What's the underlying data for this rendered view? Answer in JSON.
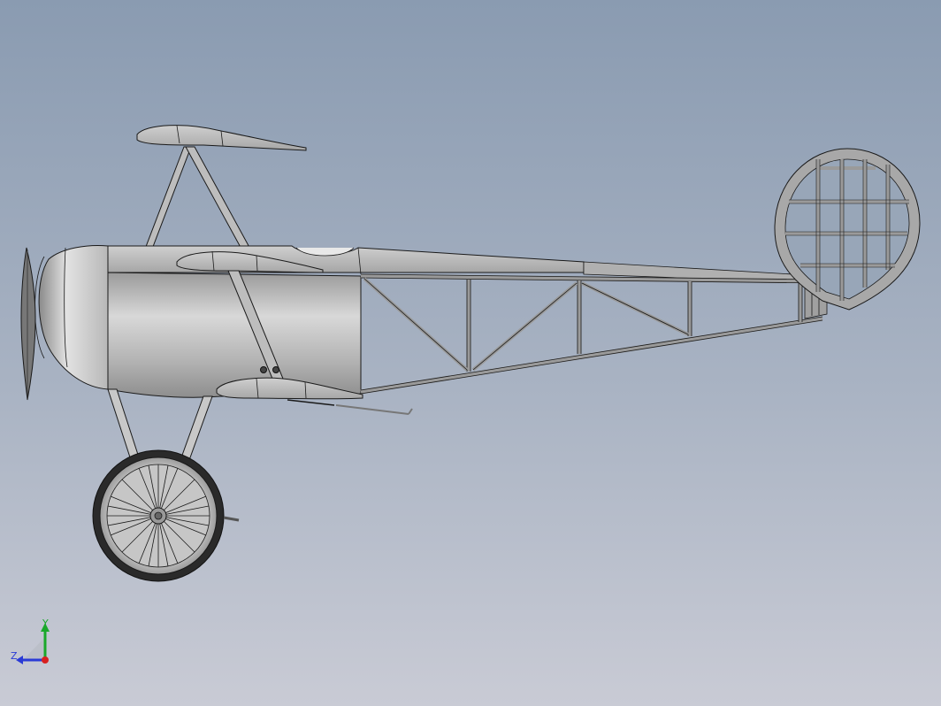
{
  "viewport": {
    "background_top": "#8a9bb1",
    "background_bottom": "#c9cbd5"
  },
  "model": {
    "description_name": "triplane-side-view",
    "body_color": "#bcbcbc",
    "frame_color": "#9a9a9a",
    "edge_color": "#1a1a1a"
  },
  "triad": {
    "y_label": "Y",
    "z_label": "Z",
    "y_color": "#1aa82a",
    "z_color": "#2a3bd6",
    "x_color": "#d82020"
  }
}
